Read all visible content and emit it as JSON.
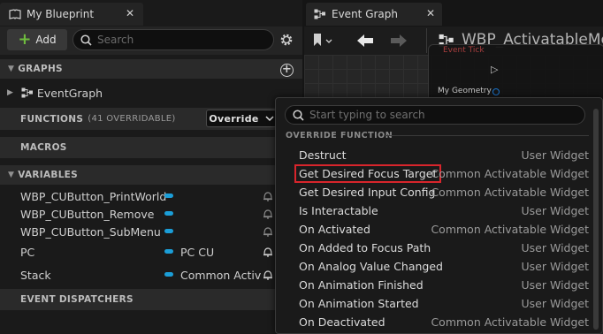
{
  "blueprint_tab": {
    "title": "My Blueprint",
    "close": "✕"
  },
  "toolbar": {
    "add_label": "Add",
    "search_placeholder": "Search"
  },
  "graphs": {
    "header": "GRAPHS",
    "items": [
      {
        "label": "EventGraph"
      }
    ]
  },
  "functions": {
    "header": "FUNCTIONS",
    "count": "(41 OVERRIDABLE)",
    "override_label": "Override"
  },
  "macros": {
    "header": "MACROS"
  },
  "variables": {
    "header": "VARIABLES",
    "items": [
      {
        "name": "WBP_CUButton_PrintWorld",
        "type": ""
      },
      {
        "name": "WBP_CUButton_Remove",
        "type": ""
      },
      {
        "name": "WBP_CUButton_SubMenu",
        "type": ""
      },
      {
        "name": "PC",
        "type": "PC CU"
      },
      {
        "name": "Stack",
        "type": "Common Activ"
      }
    ]
  },
  "event_dispatchers": {
    "header": "EVENT DISPATCHERS"
  },
  "graph_tab": {
    "title": "Event Graph",
    "close": "✕"
  },
  "graph_toolbar": {
    "node_title": "WBP_ActivatableMe"
  },
  "graph_node": {
    "pin1": "Event Tick",
    "pin2": "My Geometry"
  },
  "popup": {
    "search_placeholder": "Start typing to search",
    "heading": "OVERRIDE FUNCTION",
    "options": [
      {
        "name": "Destruct",
        "category": "User Widget"
      },
      {
        "name": "Get Desired Focus Target",
        "category": "Common Activatable Widget"
      },
      {
        "name": "Get Desired Input Config",
        "category": "Common Activatable Widget"
      },
      {
        "name": "Is Interactable",
        "category": "User Widget"
      },
      {
        "name": "On Activated",
        "category": "Common Activatable Widget"
      },
      {
        "name": "On Added to Focus Path",
        "category": "User Widget"
      },
      {
        "name": "On Analog Value Changed",
        "category": "User Widget"
      },
      {
        "name": "On Animation Finished",
        "category": "User Widget"
      },
      {
        "name": "On Animation Started",
        "category": "User Widget"
      },
      {
        "name": "On Deactivated",
        "category": "Common Activatable Widget"
      }
    ]
  },
  "colors": {
    "accent_green": "#6ebc3e",
    "variable_pill": "#1b9ed8",
    "highlight_box": "#d8252c"
  }
}
